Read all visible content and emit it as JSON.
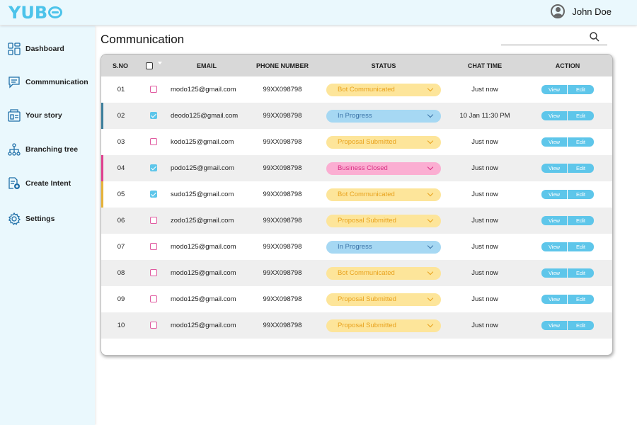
{
  "app": {
    "logo_text": "YUB",
    "user_name": "John Doe"
  },
  "sidebar": {
    "items": [
      {
        "label": "Dashboard",
        "icon": "dashboard-icon"
      },
      {
        "label": "Commmunication",
        "icon": "chat-icon"
      },
      {
        "label": "Your story",
        "icon": "story-icon"
      },
      {
        "label": "Branching tree",
        "icon": "branching-tree-icon"
      },
      {
        "label": "Create Intent",
        "icon": "create-intent-icon"
      },
      {
        "label": "Settings",
        "icon": "gear-icon"
      }
    ]
  },
  "main": {
    "title": "Communication",
    "search": {
      "value": "",
      "placeholder": ""
    }
  },
  "colors": {
    "accent": "#5ec6ea",
    "sidebar_bg": "#eaf8fd",
    "status_yellow": "#fde59a",
    "status_yellow_text": "#e8a21d",
    "status_blue": "#a6d8f3",
    "status_blue_text": "#3b74a8",
    "status_pink": "#fbaed2",
    "status_pink_text": "#d82d82"
  },
  "table": {
    "columns": [
      "S.NO",
      "EMAIL",
      "PHONE NUMBER",
      "STATUS",
      "CHAT TIME",
      "ACTION"
    ],
    "action_view": "View",
    "action_edit": "Edit",
    "rows": [
      {
        "sno": "01",
        "checked": false,
        "email": "modo125@gmail.com",
        "phone": "99XX098798",
        "status": "Bot Communicated",
        "status_color": "yellow",
        "chat_time": "Just now",
        "accent": ""
      },
      {
        "sno": "02",
        "checked": true,
        "email": "deodo125@gmail.com",
        "phone": "99XX098798",
        "status": "In Progress",
        "status_color": "blue",
        "chat_time": "10 Jan 11:30 PM",
        "accent": "#3d7f9c"
      },
      {
        "sno": "03",
        "checked": false,
        "email": "kodo125@gmail.com",
        "phone": "99XX098798",
        "status": "Proposal Submitted",
        "status_color": "yellow",
        "chat_time": "Just now",
        "accent": ""
      },
      {
        "sno": "04",
        "checked": true,
        "email": "podo125@gmail.com",
        "phone": "99XX098798",
        "status": "Business Closed",
        "status_color": "pink",
        "chat_time": "Just now",
        "accent": "#e0408f"
      },
      {
        "sno": "05",
        "checked": true,
        "email": "sudo125@gmail.com",
        "phone": "99XX098798",
        "status": "Bot Communicated",
        "status_color": "yellow",
        "chat_time": "Just now",
        "accent": "#e6b33a"
      },
      {
        "sno": "06",
        "checked": false,
        "email": "zodo125@gmail.com",
        "phone": "99XX098798",
        "status": "Proposal Submitted",
        "status_color": "yellow",
        "chat_time": "Just now",
        "accent": ""
      },
      {
        "sno": "07",
        "checked": false,
        "email": "modo125@gmail.com",
        "phone": "99XX098798",
        "status": "In Progress",
        "status_color": "blue",
        "chat_time": "Just now",
        "accent": ""
      },
      {
        "sno": "08",
        "checked": false,
        "email": "modo125@gmail.com",
        "phone": "99XX098798",
        "status": "Bot Communicated",
        "status_color": "yellow",
        "chat_time": "Just now",
        "accent": ""
      },
      {
        "sno": "09",
        "checked": false,
        "email": "modo125@gmail.com",
        "phone": "99XX098798",
        "status": "Proposal Submitted",
        "status_color": "yellow",
        "chat_time": "Just now",
        "accent": ""
      },
      {
        "sno": "10",
        "checked": false,
        "email": "modo125@gmail.com",
        "phone": "99XX098798",
        "status": "Proposal Submitted",
        "status_color": "yellow",
        "chat_time": "Just now",
        "accent": ""
      }
    ]
  }
}
